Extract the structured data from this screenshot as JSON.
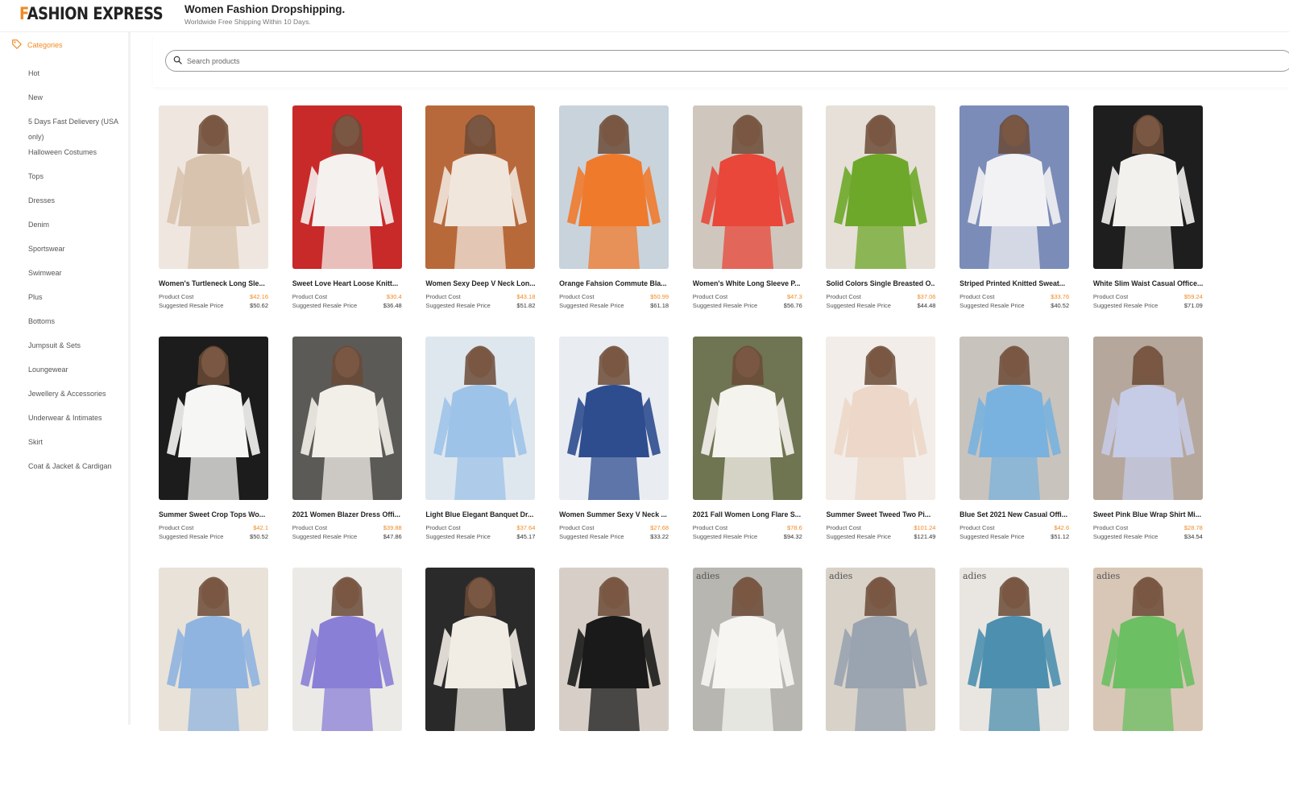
{
  "header": {
    "logo_first": "F",
    "logo_rest": "ASHION EXPRESS",
    "title": "Women Fashion Dropshipping.",
    "subtitle": "Worldwide Free Shipping Within 10 Days."
  },
  "sidebar": {
    "heading": "Categories",
    "heading_icon": "tag-icon",
    "items": [
      {
        "label": "Hot"
      },
      {
        "label": "New"
      },
      {
        "label": "5 Days Fast Delievery (USA only)"
      },
      {
        "label": "Halloween Costumes"
      },
      {
        "label": "Tops"
      },
      {
        "label": "Dresses"
      },
      {
        "label": "Denim"
      },
      {
        "label": "Sportswear"
      },
      {
        "label": "Swimwear"
      },
      {
        "label": "Plus"
      },
      {
        "label": "Bottoms"
      },
      {
        "label": "Jumpsuit & Sets"
      },
      {
        "label": "Loungewear"
      },
      {
        "label": "Jewellery & Accessories"
      },
      {
        "label": "Underwear & Intimates"
      },
      {
        "label": "Skirt"
      },
      {
        "label": "Coat & Jacket & Cardigan"
      }
    ]
  },
  "search": {
    "placeholder": "Search products",
    "icon": "search-icon"
  },
  "labels": {
    "product_cost": "Product Cost",
    "suggested_resale": "Suggested Resale Price"
  },
  "colors": {
    "accent": "#f08a24"
  },
  "products": [
    {
      "name": "Women's Turtleneck Long Sle...",
      "cost": "$42.16",
      "resale": "$50.62",
      "c1": "#d8c3ae",
      "c2": "#efe7df"
    },
    {
      "name": "Sweet Love Heart Loose Knitt...",
      "cost": "$30.4",
      "resale": "$36.48",
      "c1": "#f4f1ee",
      "c2": "#c82a2a"
    },
    {
      "name": "Women Sexy Deep V Neck Lon...",
      "cost": "$43.18",
      "resale": "$51.82",
      "c1": "#f1e6dc",
      "c2": "#b8693b"
    },
    {
      "name": "Orange Fahsion Commute Bla...",
      "cost": "$50.99",
      "resale": "$61.18",
      "c1": "#f07a2c",
      "c2": "#c9d3dc"
    },
    {
      "name": "Women's White Long Sleeve P...",
      "cost": "$47.3",
      "resale": "$56.76",
      "c1": "#e8473a",
      "c2": "#cfc7bd"
    },
    {
      "name": "Solid Colors Single Breasted O...",
      "cost": "$37.06",
      "resale": "$44.48",
      "c1": "#6ea82a",
      "c2": "#e6e0d8"
    },
    {
      "name": "Striped Printed Knitted Sweat...",
      "cost": "$33.76",
      "resale": "$40.52",
      "c1": "#f2f2f4",
      "c2": "#7b8cb8"
    },
    {
      "name": "White Slim Waist Casual Office...",
      "cost": "$59.24",
      "resale": "$71.09",
      "c1": "#f3f1ee",
      "c2": "#1e1e1e"
    },
    {
      "name": "Summer Sweet Crop Tops Wo...",
      "cost": "$42.1",
      "resale": "$50.52",
      "c1": "#f6f6f4",
      "c2": "#1c1c1c"
    },
    {
      "name": "2021 Women Blazer Dress Offi...",
      "cost": "$39.88",
      "resale": "$47.86",
      "c1": "#f2efe8",
      "c2": "#5b5a57"
    },
    {
      "name": "Light Blue Elegant Banquet Dr...",
      "cost": "$37.64",
      "resale": "$45.17",
      "c1": "#9ec3e8",
      "c2": "#dfe7ee"
    },
    {
      "name": "Women Summer Sexy V Neck ...",
      "cost": "$27.68",
      "resale": "$33.22",
      "c1": "#2e4d8f",
      "c2": "#e9ecf1"
    },
    {
      "name": "2021 Fall Women Long Flare S...",
      "cost": "$78.6",
      "resale": "$94.32",
      "c1": "#f5f3ee",
      "c2": "#6f7452"
    },
    {
      "name": "Summer Sweet Tweed Two Pi...",
      "cost": "$101.24",
      "resale": "$121.49",
      "c1": "#ecd7c8",
      "c2": "#f2ede9"
    },
    {
      "name": "Blue Set 2021 New Casual Offi...",
      "cost": "$42.6",
      "resale": "$51.12",
      "c1": "#79b2de",
      "c2": "#c9c3bd"
    },
    {
      "name": "Sweet Pink Blue Wrap Shirt Mi...",
      "cost": "$28.78",
      "resale": "$34.54",
      "c1": "#c6cbe6",
      "c2": "#b5a79b"
    },
    {
      "name": "",
      "cost": "",
      "resale": "",
      "c1": "#8fb4e0",
      "c2": "#e9e2d8"
    },
    {
      "name": "",
      "cost": "",
      "resale": "",
      "c1": "#8a7fd6",
      "c2": "#eceae6"
    },
    {
      "name": "",
      "cost": "",
      "resale": "",
      "c1": "#f1ece4",
      "c2": "#2a2a2a"
    },
    {
      "name": "",
      "cost": "",
      "resale": "",
      "c1": "#1a1a1a",
      "c2": "#d7cfc7"
    },
    {
      "name": "",
      "cost": "",
      "resale": "",
      "c1": "#f6f5f2",
      "c2": "#b8b6b0",
      "badge": "adies"
    },
    {
      "name": "",
      "cost": "",
      "resale": "",
      "c1": "#9aa3b0",
      "c2": "#d8d2c8",
      "badge": "adies"
    },
    {
      "name": "",
      "cost": "",
      "resale": "",
      "c1": "#4d8fae",
      "c2": "#e9e6e2",
      "badge": "adies"
    },
    {
      "name": "",
      "cost": "",
      "resale": "",
      "c1": "#6cbf63",
      "c2": "#d8c7b6",
      "badge": "adies"
    }
  ]
}
